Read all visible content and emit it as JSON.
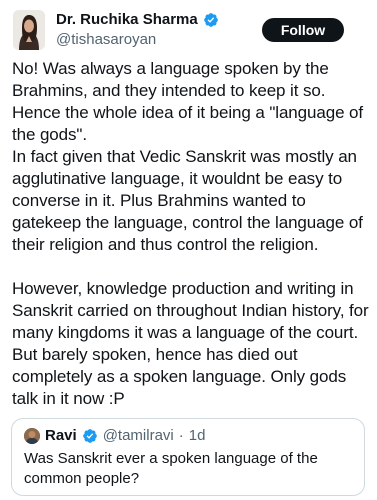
{
  "author": {
    "display_name": "Dr. Ruchika Sharma",
    "handle": "@tishasaroyan",
    "verified": true
  },
  "follow_button": {
    "label": "Follow"
  },
  "tweet": {
    "paragraphs": [
      "No! Was always a language spoken by the Brahmins, and they intended to keep it so. Hence the whole idea of it being a \"language of the gods\".",
      "In fact given that Vedic Sanskrit was mostly an agglutinative language, it wouldnt be easy to converse in it. Plus Brahmins wanted to gatekeep the language, control the language of their religion and thus control the religion.",
      "However, knowledge production and writing in Sanskrit carried on throughout Indian history, for many kingdoms it was a language of the court. But barely spoken, hence has died out completely as a spoken language. Only gods talk in it now :P"
    ]
  },
  "quoted_tweet": {
    "display_name": "Ravi",
    "handle": "@tamilravi",
    "separator": "·",
    "time": "1d",
    "verified": true,
    "text": "Was Sanskrit ever a spoken language of the common people?"
  },
  "colors": {
    "text": "#0f1419",
    "secondary": "#536471",
    "verified_blue": "#1d9bf0",
    "button_bg": "#0f1419",
    "border": "#cfd9de"
  },
  "icons": {
    "verified": "verified-badge-icon"
  }
}
